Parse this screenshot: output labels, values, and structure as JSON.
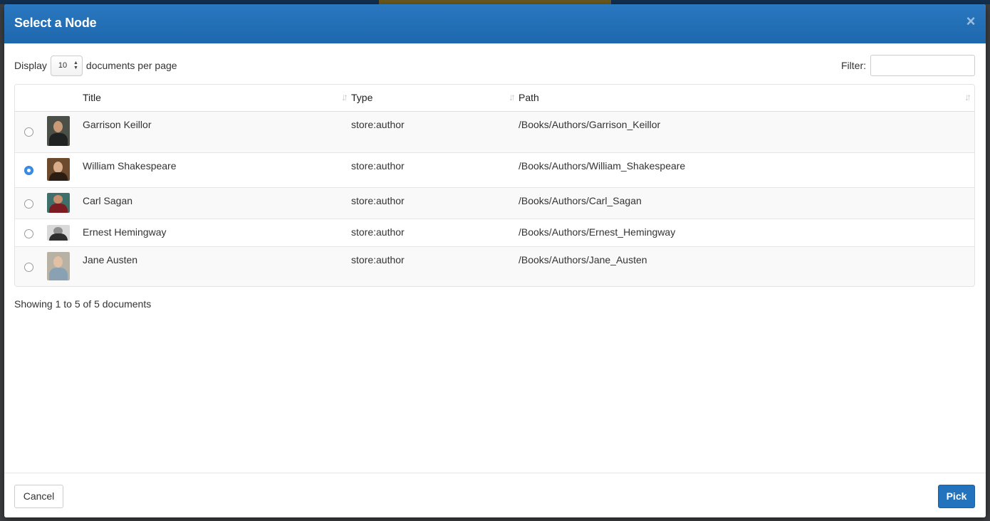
{
  "dialog": {
    "title": "Select a Node",
    "close_glyph": "×"
  },
  "length": {
    "prefix": "Display",
    "value": "10",
    "suffix": "documents per page"
  },
  "filter": {
    "label": "Filter:",
    "value": ""
  },
  "table": {
    "columns": [
      "Title",
      "Type",
      "Path"
    ],
    "rows": [
      {
        "title": "Garrison Keillor",
        "type": "store:author",
        "path": "/Books/Authors/Garrison_Keillor",
        "selected": false
      },
      {
        "title": "William Shakespeare",
        "type": "store:author",
        "path": "/Books/Authors/William_Shakespeare",
        "selected": true
      },
      {
        "title": "Carl Sagan",
        "type": "store:author",
        "path": "/Books/Authors/Carl_Sagan",
        "selected": false
      },
      {
        "title": "Ernest Hemingway",
        "type": "store:author",
        "path": "/Books/Authors/Ernest_Hemingway",
        "selected": false
      },
      {
        "title": "Jane Austen",
        "type": "store:author",
        "path": "/Books/Authors/Jane_Austen",
        "selected": false
      }
    ]
  },
  "info": "Showing 1 to 5 of 5 documents",
  "footer": {
    "cancel_label": "Cancel",
    "pick_label": "Pick"
  },
  "colors": {
    "header": "#2272bd",
    "primary_button": "#2272bd",
    "radio_checked": "#3a8ee6"
  }
}
